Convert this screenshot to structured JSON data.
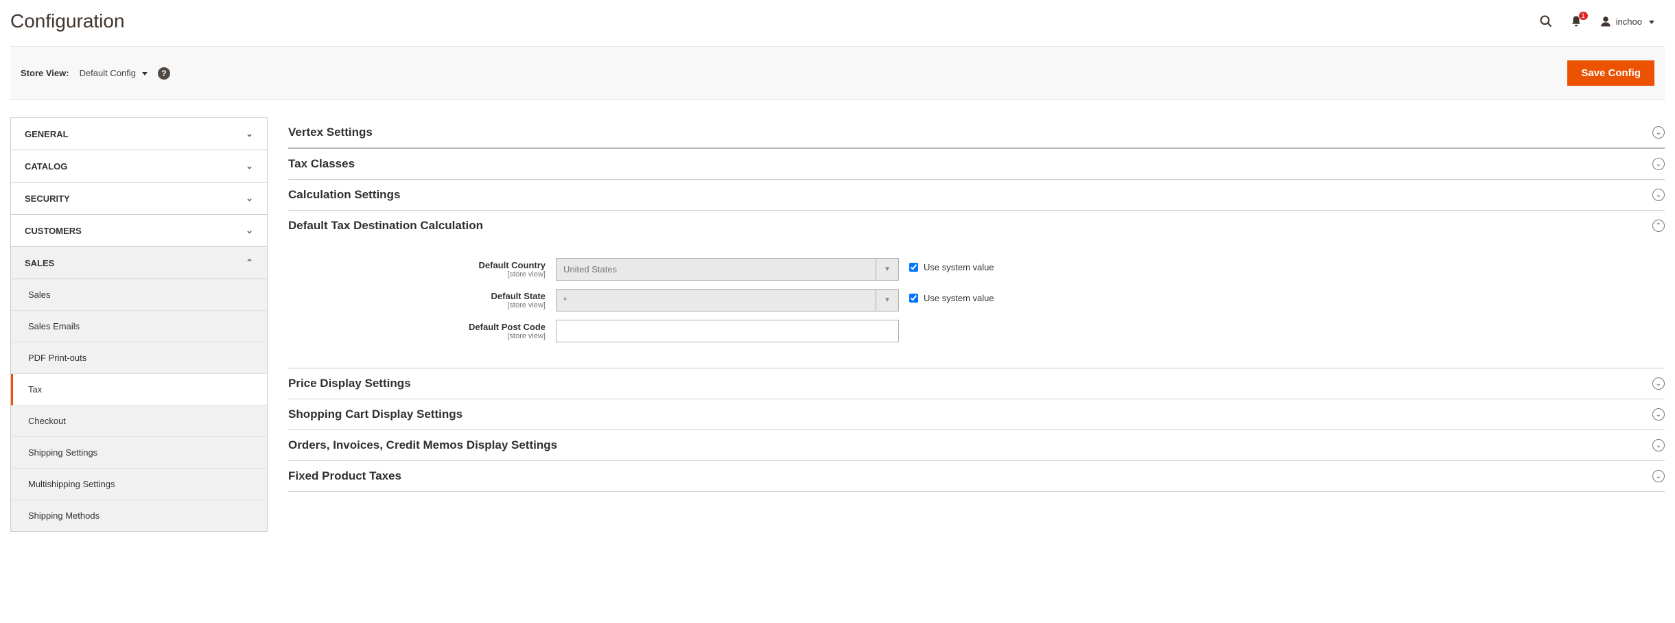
{
  "page": {
    "title": "Configuration"
  },
  "header": {
    "notification_count": "1",
    "username": "inchoo"
  },
  "toolbar": {
    "store_view_label": "Store View:",
    "store_view_value": "Default Config",
    "save_label": "Save Config"
  },
  "sidebar": {
    "tabs": [
      {
        "label": "GENERAL",
        "expanded": false
      },
      {
        "label": "CATALOG",
        "expanded": false
      },
      {
        "label": "SECURITY",
        "expanded": false
      },
      {
        "label": "CUSTOMERS",
        "expanded": false
      },
      {
        "label": "SALES",
        "expanded": true
      }
    ],
    "sales_items": [
      {
        "label": "Sales",
        "active": false
      },
      {
        "label": "Sales Emails",
        "active": false
      },
      {
        "label": "PDF Print-outs",
        "active": false
      },
      {
        "label": "Tax",
        "active": true
      },
      {
        "label": "Checkout",
        "active": false
      },
      {
        "label": "Shipping Settings",
        "active": false
      },
      {
        "label": "Multishipping Settings",
        "active": false
      },
      {
        "label": "Shipping Methods",
        "active": false
      }
    ]
  },
  "sections": {
    "vertex": "Vertex Settings",
    "tax_classes": "Tax Classes",
    "calculation": "Calculation Settings",
    "default_tax_dest": "Default Tax Destination Calculation",
    "price_display": "Price Display Settings",
    "cart_display": "Shopping Cart Display Settings",
    "orders_display": "Orders, Invoices, Credit Memos Display Settings",
    "fpt": "Fixed Product Taxes"
  },
  "form": {
    "scope_text": "[store view]",
    "use_system_value": "Use system value",
    "default_country": {
      "label": "Default Country",
      "value": "United States"
    },
    "default_state": {
      "label": "Default State",
      "value": "*"
    },
    "default_post_code": {
      "label": "Default Post Code",
      "value": ""
    }
  }
}
